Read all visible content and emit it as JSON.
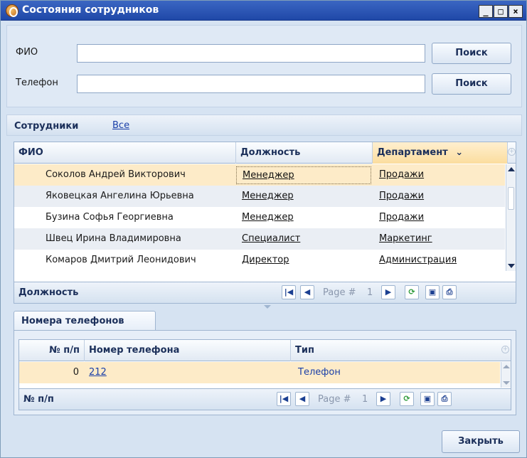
{
  "window": {
    "title": "Состояния сотрудников",
    "min_label": "_",
    "max_label": "□",
    "close_label": "×"
  },
  "search": {
    "fio_label": "ФИО",
    "fio_value": "",
    "phone_label": "Телефон",
    "phone_value": "",
    "search_button": "Поиск"
  },
  "employees": {
    "section_title": "Сотрудники",
    "filter_link": "Все",
    "columns": [
      "ФИО",
      "Должность",
      "Департамент"
    ],
    "sort_indicator": "⌄",
    "rows": [
      {
        "fio": "Соколов Андрей Викторович",
        "position": "Менеджер",
        "department": "Продажи"
      },
      {
        "fio": "Яковецкая Ангелина Юрьевна",
        "position": "Менеджер",
        "department": "Продажи"
      },
      {
        "fio": "Бузина Софья Георгиевна",
        "position": "Менеджер",
        "department": "Продажи"
      },
      {
        "fio": "Швец Ирина Владимировна",
        "position": "Специалист",
        "department": "Маркетинг"
      },
      {
        "fio": "Комаров Дмитрий Леонидович",
        "position": "Директор",
        "department": "Администрация"
      }
    ],
    "pager_label": "Должность",
    "page_label": "Page #",
    "page_number": "1"
  },
  "phones": {
    "tab_label": "Номера телефонов",
    "columns": [
      "№ п/п",
      "Номер телефона",
      "Тип"
    ],
    "rows": [
      {
        "index": "0",
        "number": "212",
        "type": "Телефон"
      }
    ],
    "pager_label": "№ п/п",
    "page_label": "Page #",
    "page_number": "1"
  },
  "footer": {
    "close_button": "Закрыть"
  },
  "colors": {
    "selected_row": "#fdebc8",
    "sorted_header": "#fbdd9e",
    "title_bar": "#2a55b5"
  }
}
